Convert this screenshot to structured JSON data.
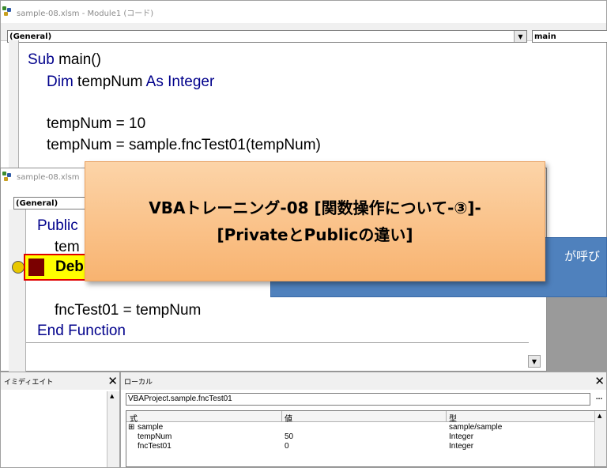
{
  "window1": {
    "title": "sample-08.xlsm - Module1 (コード)",
    "object_combo": "(General)",
    "proc_combo": "main",
    "code": {
      "l1_kw": "Sub",
      "l1_rest": " main()",
      "l2_kw": "Dim",
      "l2_mid": " tempNum ",
      "l2_kw2": "As",
      "l2_sp": " ",
      "l2_kw3": "Integer",
      "l3": "tempNum = 10",
      "l4": "tempNum = sample.fncTest01(tempNum)"
    }
  },
  "window2": {
    "title": "sample-08.xlsm",
    "object_combo": "(General)",
    "code": {
      "l1_kw": "Public",
      "l2": "tem",
      "l3": "Deb",
      "l4": "fncTest01 = tempNum",
      "l5_kw": "End Function"
    }
  },
  "popup_text": "が呼び",
  "banner": {
    "line1": "VBAトレーニング-08 [関数操作について-③]-",
    "line2": "[PrivateとPublicの違い]"
  },
  "immediate": {
    "title": "イミディエイト",
    "close": "✕"
  },
  "locals": {
    "title": "ローカル",
    "close": "✕",
    "context": "VBAProject.sample.fncTest01",
    "more": "...",
    "columns": [
      "式",
      "値",
      "型"
    ],
    "rows": [
      {
        "expr": "sample",
        "value": "",
        "type": "sample/sample",
        "expand": "⊞"
      },
      {
        "expr": "tempNum",
        "value": "50",
        "type": "Integer",
        "expand": ""
      },
      {
        "expr": "fncTest01",
        "value": "0",
        "type": "Integer",
        "expand": ""
      }
    ]
  },
  "colors": {
    "blue_popup": "#4f81bd",
    "banner": "#f8b370",
    "keyword": "#00008b"
  }
}
